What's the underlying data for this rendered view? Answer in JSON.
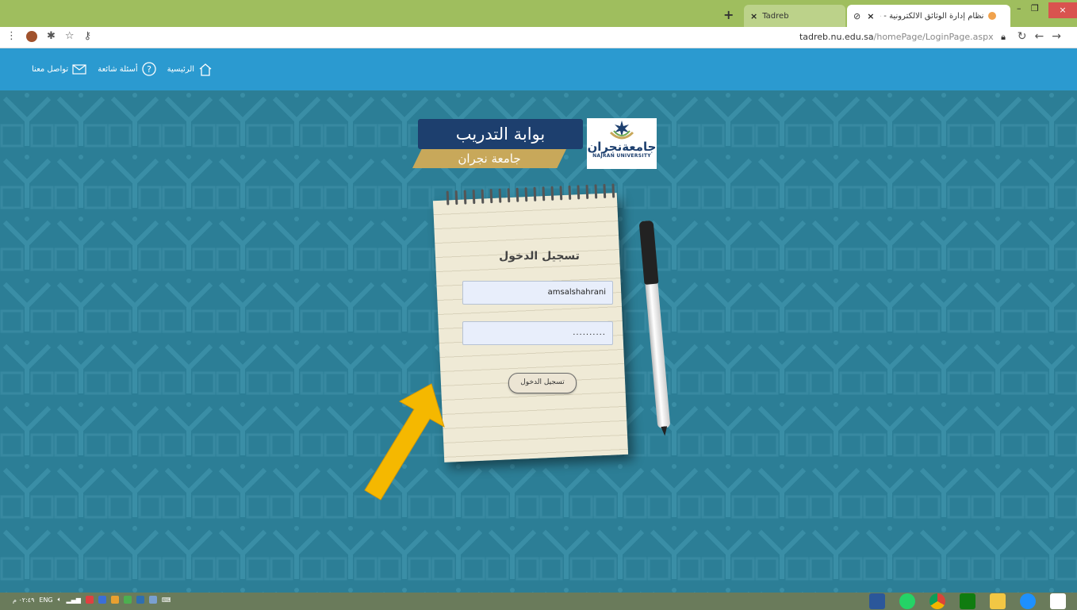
{
  "browser": {
    "tabs": [
      {
        "title": "نظام إدارة الوثائق الالكترونية - جامعة",
        "active": true
      },
      {
        "title": "Tadreb",
        "active": false
      }
    ],
    "new_tab_glyph": "+",
    "close_glyph": "×",
    "url_host": "tadreb.nu.edu.sa",
    "url_path": "/homePage/LoginPage.aspx",
    "window_controls": {
      "minimize": "–",
      "maximize": "❐",
      "close": "×"
    }
  },
  "site_nav": {
    "items": [
      {
        "label": "الرئيسية",
        "icon": "home-icon"
      },
      {
        "label": "أسئلة شائعة",
        "icon": "question-icon"
      },
      {
        "label": "تواصل معنا",
        "icon": "mail-icon"
      }
    ]
  },
  "logo": {
    "title": "بوابة التدريب",
    "subtitle": "جامعة نجران",
    "emblem_ar": "جامعةنجران",
    "emblem_en": "NAJRAN UNIVERSITY"
  },
  "login": {
    "title": "تسجيل الدخول",
    "username_value": "amsalshahrani",
    "password_value": "..........",
    "submit_label": "تسجيل الدخول"
  },
  "taskbar": {
    "time": "٠٢:٤٩ م",
    "language": "ENG"
  },
  "colors": {
    "header": "#2b9ad0",
    "background": "#2c7e96",
    "logo_navy": "#1d3f6e",
    "logo_gold": "#c8a85a",
    "arrow": "#f5b800"
  }
}
